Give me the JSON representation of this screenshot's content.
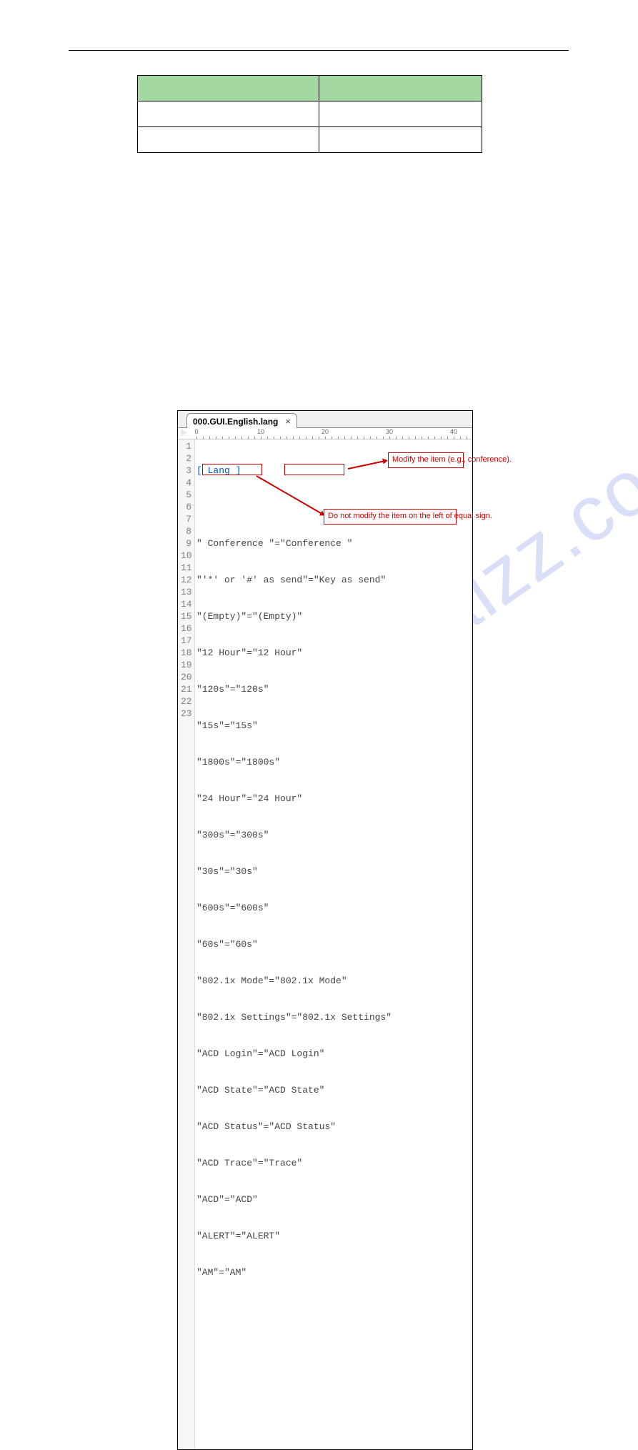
{
  "watermark": "manualzz.com",
  "table": {
    "headerLeft": "",
    "headerRight": "",
    "rows": [
      [
        "",
        ""
      ],
      [
        "",
        ""
      ]
    ]
  },
  "editor": {
    "tabTitle": "000.GUI.English.lang",
    "rulerLabels": [
      "0",
      "10",
      "20",
      "30",
      "40"
    ],
    "lines": [
      "[ Lang ]",
      "",
      "\" Conference \"=\"Conference \"",
      "\"'*' or '#' as send\"=\"Key as send\"",
      "\"(Empty)\"=\"(Empty)\"",
      "\"12 Hour\"=\"12 Hour\"",
      "\"120s\"=\"120s\"",
      "\"15s\"=\"15s\"",
      "\"1800s\"=\"1800s\"",
      "\"24 Hour\"=\"24 Hour\"",
      "\"300s\"=\"300s\"",
      "\"30s\"=\"30s\"",
      "\"600s\"=\"600s\"",
      "\"60s\"=\"60s\"",
      "\"802.1x Mode\"=\"802.1x Mode\"",
      "\"802.1x Settings\"=\"802.1x Settings\"",
      "\"ACD Login\"=\"ACD Login\"",
      "\"ACD State\"=\"ACD State\"",
      "\"ACD Status\"=\"ACD Status\"",
      "\"ACD Trace\"=\"Trace\"",
      "\"ACD\"=\"ACD\"",
      "\"ALERT\"=\"ALERT\"",
      "\"AM\"=\"AM\""
    ],
    "callout1": "Modify the item (e.g., conference).",
    "callout2": "Do not modify the item on the left of equal sign."
  }
}
